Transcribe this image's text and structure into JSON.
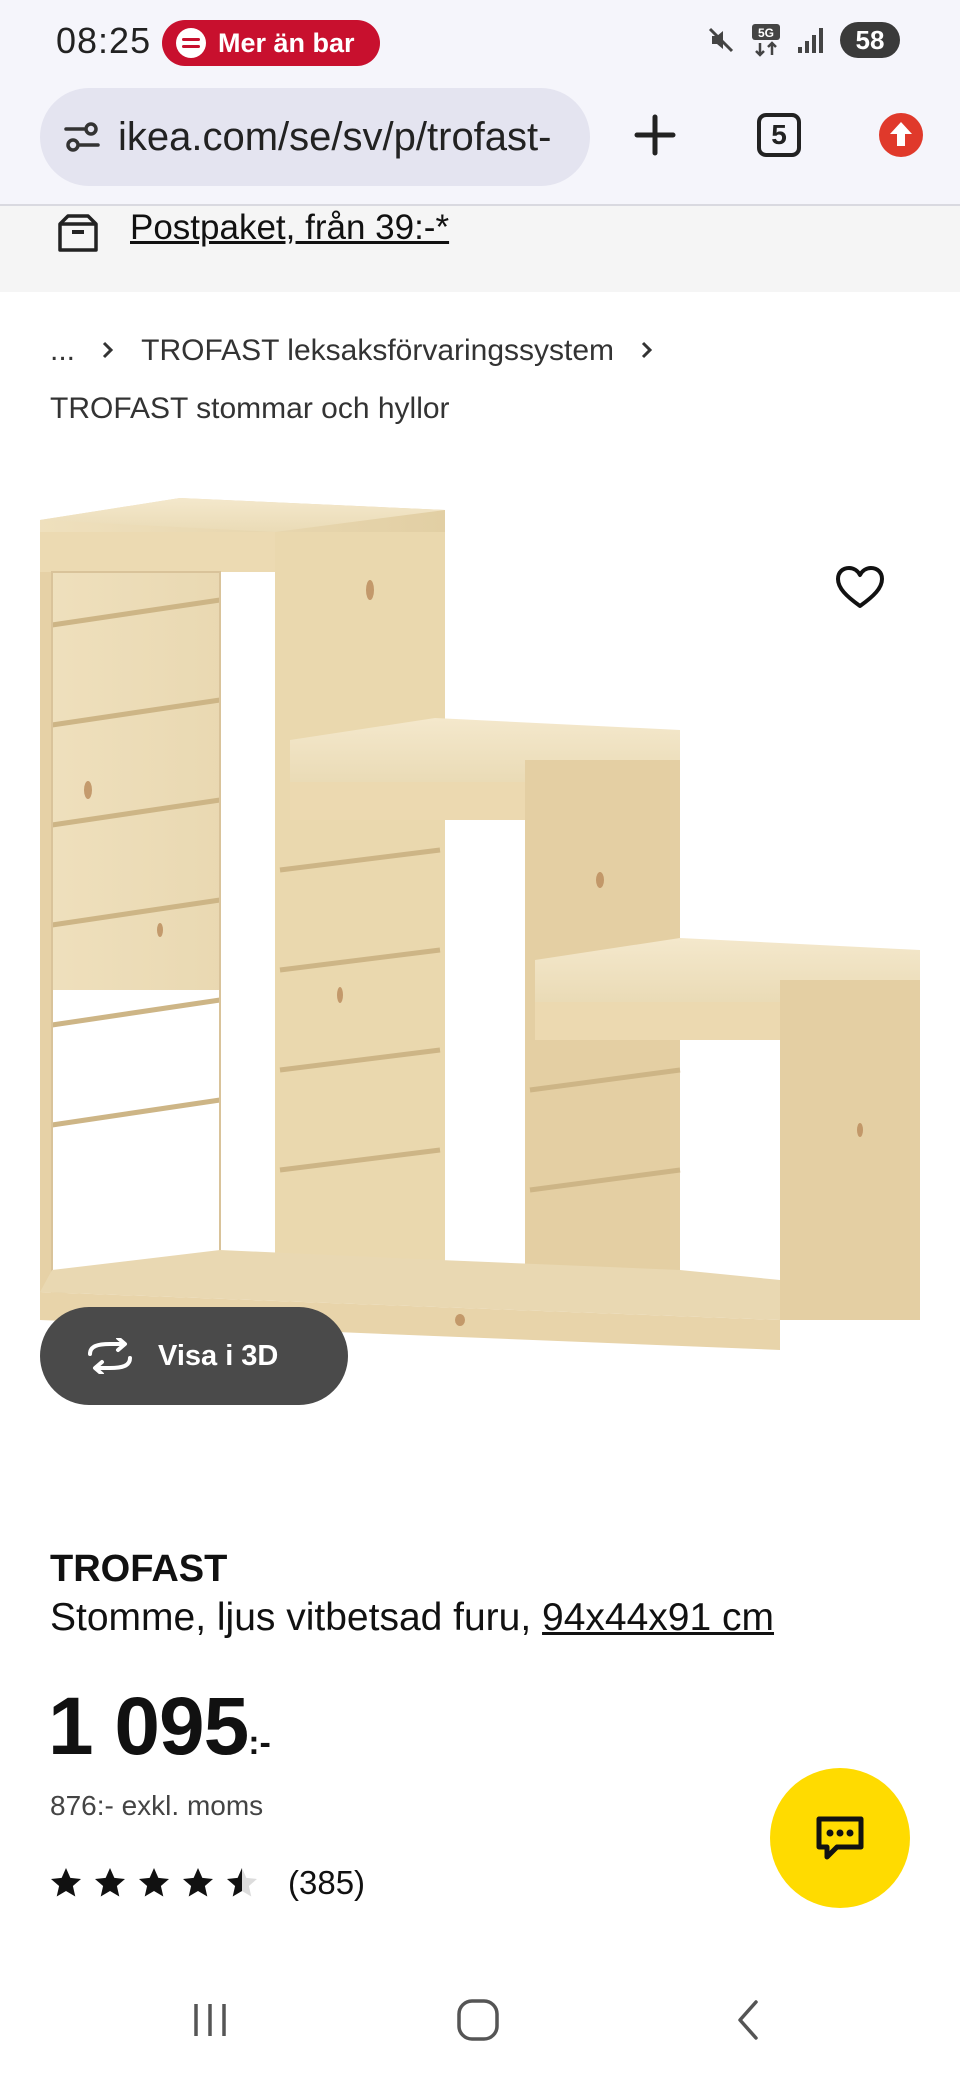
{
  "status_bar": {
    "time": "08:25",
    "spotify_text": "Mer än bar",
    "battery": "58"
  },
  "browser": {
    "url": "ikea.com/se/sv/p/trofast-",
    "tab_count": "5"
  },
  "delivery": {
    "text": "Postpaket, från 39:-*"
  },
  "breadcrumb": {
    "ellipsis": "...",
    "level1": "TROFAST leksaksförvaringssystem",
    "level2": "TROFAST stommar och hyllor"
  },
  "product": {
    "view_3d_label": "Visa i 3D",
    "name": "TROFAST",
    "description": "Stomme, ljus vitbetsad furu, ",
    "dimensions": "94x44x91 cm",
    "price": "1 095",
    "price_suffix": ":-",
    "price_excl_vat": "876:- exkl. moms",
    "rating": 4.5,
    "review_count": "(385)"
  },
  "colors": {
    "brand_yellow": "#ffdb00",
    "spotify_red": "#c8102e",
    "wood": "#ecdcb6"
  }
}
